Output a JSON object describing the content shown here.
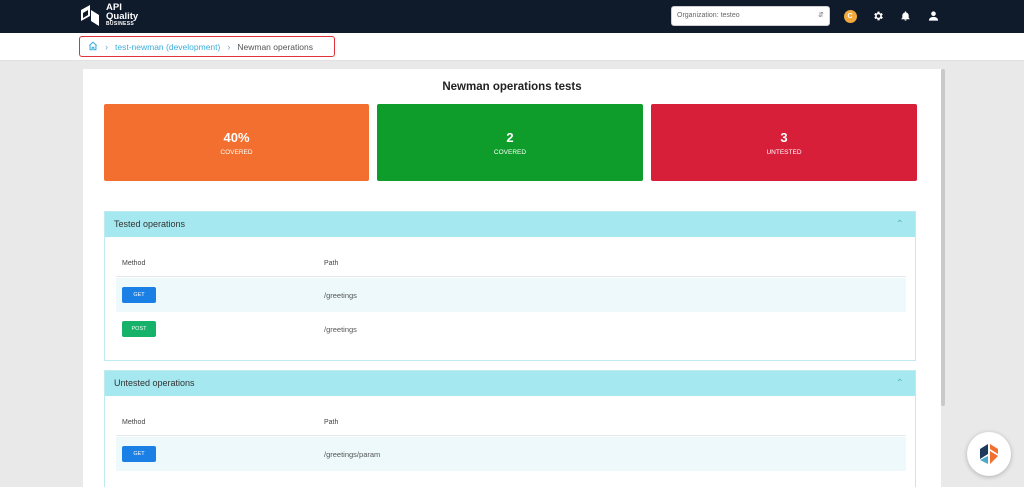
{
  "app": {
    "logo_line1": "API",
    "logo_line2": "Quality",
    "logo_line3": "BUSINESS"
  },
  "topbar": {
    "organization_text": "Organization: testeo",
    "coin_label": "C",
    "icons": [
      "coin-icon",
      "gear-icon",
      "bell-icon",
      "user-icon"
    ]
  },
  "breadcrumb": {
    "home_icon": "home-icon",
    "project": "test-newman (development)",
    "current": "Newman operations"
  },
  "page": {
    "title": "Newman operations tests"
  },
  "stats": [
    {
      "value": "40%",
      "label": "COVERED",
      "color": "#f26f2f"
    },
    {
      "value": "2",
      "label": "COVERED",
      "color": "#0e9d2a"
    },
    {
      "value": "3",
      "label": "UNTESTED",
      "color": "#d71f3a"
    }
  ],
  "tested": {
    "title": "Tested operations",
    "col_method": "Method",
    "col_path": "Path",
    "rows": [
      {
        "method": "GET",
        "path": "/greetings",
        "color": "#1a80e5"
      },
      {
        "method": "POST",
        "path": "/greetings",
        "color": "#16b26a"
      }
    ]
  },
  "untested": {
    "title": "Untested operations",
    "col_method": "Method",
    "col_path": "Path",
    "rows": [
      {
        "method": "GET",
        "path": "/greetings/param",
        "color": "#1a80e5"
      }
    ]
  },
  "colors": {
    "topbar": "#0f1a2b",
    "section_header": "#a5e8ef",
    "link": "#3aaed9"
  }
}
